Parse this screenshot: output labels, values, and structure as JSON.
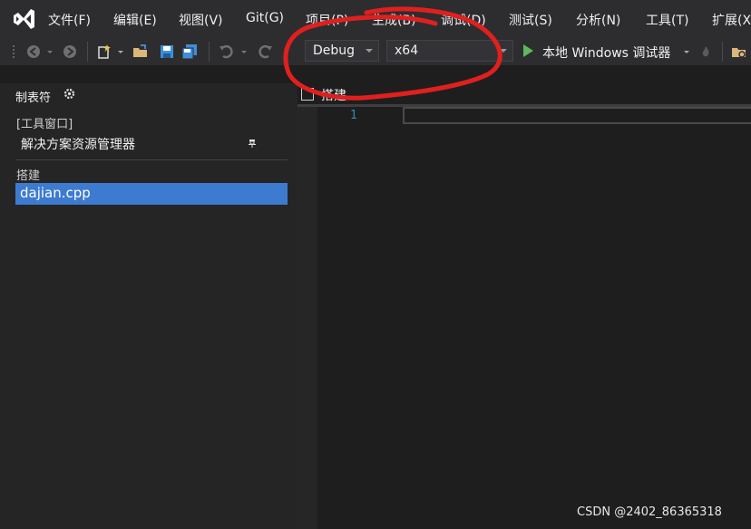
{
  "menu": {
    "items": [
      "文件(F)",
      "编辑(E)",
      "视图(V)",
      "Git(G)",
      "项目(P)",
      "生成(B)",
      "调试(D)",
      "测试(S)",
      "分析(N)",
      "工具(T)",
      "扩展(X"
    ]
  },
  "toolbar": {
    "config_value": "Debug",
    "platform_value": "x64",
    "run_label": "本地 Windows 调试器"
  },
  "panel": {
    "title": "制表符",
    "group1_label": "[工具窗口]",
    "group1_item": "解决方案资源管理器",
    "group2_label": "搭建",
    "group2_item": "dajian.cpp"
  },
  "editor": {
    "tab_label": "搭建",
    "line_number": "1"
  },
  "watermark": "CSDN @2402_86365318",
  "colors": {
    "accent_selected": "#3d7bd0",
    "annotation": "#e0201e",
    "run_green": "#5fb85c"
  }
}
